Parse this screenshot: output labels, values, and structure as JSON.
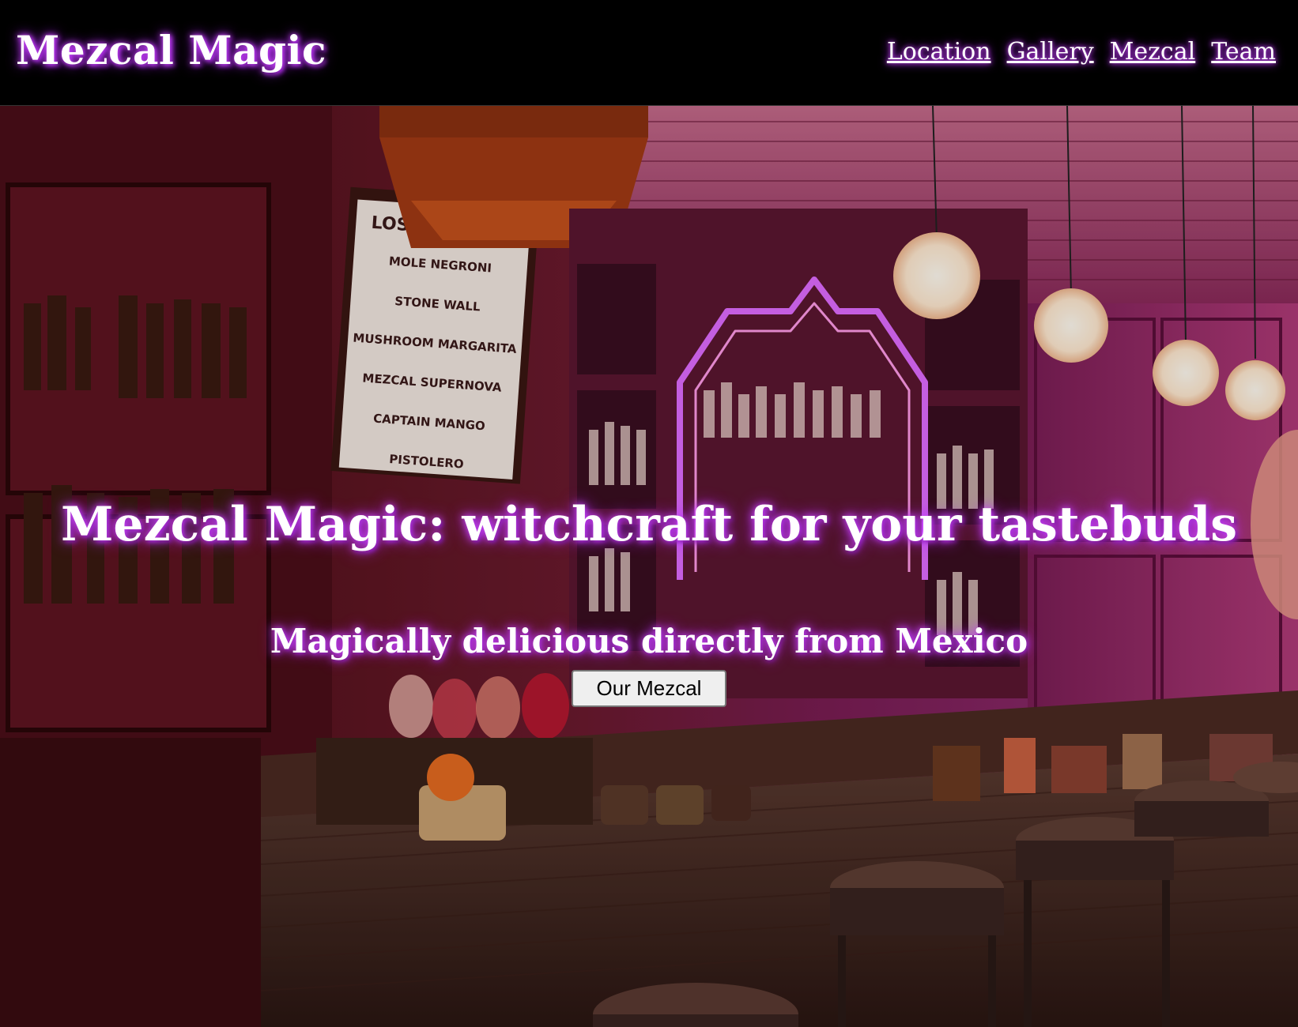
{
  "header": {
    "brand": "Mezcal Magic",
    "nav": [
      {
        "label": "Location"
      },
      {
        "label": "Gallery"
      },
      {
        "label": "Mezcal"
      },
      {
        "label": "Team"
      }
    ]
  },
  "hero": {
    "title": "Mezcal Magic: witchcraft for your tastebuds",
    "subtitle": "Magically delicious directly from Mexico",
    "button_label": "Our Mezcal",
    "menu_board": [
      "LOS CÓCTELES",
      "MOLE NEGRONI",
      "STONE WALL",
      "MUSHROOM MARGARITA",
      "MEZCAL SUPERNOVA",
      "CAPTAIN MANGO",
      "PISTOLERO"
    ]
  },
  "colors": {
    "glow": "#d14cff",
    "neon": "#c026ff",
    "background": "#000000"
  }
}
